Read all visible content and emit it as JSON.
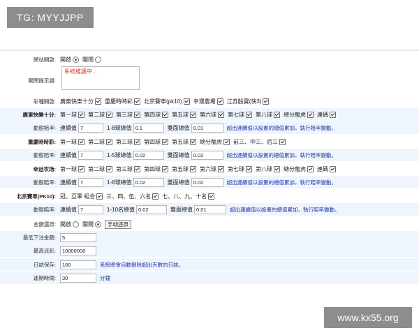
{
  "watermarks": {
    "tg": "TG: MYYJJPP",
    "site": "www.kx55.org"
  },
  "colors": {
    "row_alt": "#eef5fc",
    "hint": "#2233a6",
    "alert_text": "#e0321d"
  },
  "site_status": {
    "label": "網站開啟:",
    "on": "開啟",
    "off": "關閉",
    "selected": "on"
  },
  "close_notice": {
    "label": "關閉提示語:",
    "value": "系統維護中..."
  },
  "lottery_switch": {
    "label": "彩種開啟:",
    "items": [
      "廣東快樂十分",
      "重慶時時彩",
      "北京賽車(pk10)",
      "幸運農場",
      "江苏骰寶(快3)"
    ]
  },
  "gd": {
    "label": "廣東快樂十分:",
    "items": [
      "第一球",
      "第二球",
      "第三球",
      "第四球",
      "第五球",
      "第六球",
      "第七球",
      "第八球",
      "總分龍虎",
      "連碼"
    ],
    "trend_label": "動態賠率:",
    "k1": "連續值",
    "v1": "7",
    "k2": "1-8球總值",
    "v2": "0.1",
    "k3": "雙面總值",
    "v3": "0.01",
    "hint": "超出連續值以設置的總值累加，執行賠率變動。"
  },
  "cq": {
    "label": "重慶時時彩:",
    "items": [
      "第一球",
      "第二球",
      "第三球",
      "第四球",
      "第五球",
      "總分龍虎",
      "前三、中三、后三"
    ],
    "trend_label": "動態賠率:",
    "k1": "連續值",
    "v1": "7",
    "k2": "1-5球總值",
    "v2": "0.02",
    "k3": "雙面總值",
    "v3": "0.02",
    "hint": "超出連續值以設置的總值累加，執行賠率變動。"
  },
  "xy": {
    "label": "幸运农场:",
    "items": [
      "第一球",
      "第二球",
      "第三球",
      "第四球",
      "第五球",
      "第六球",
      "第七球",
      "第八球",
      "總分龍虎",
      "連碼"
    ],
    "trend_label": "動態賠率:",
    "k1": "連續值",
    "v1": "7",
    "k2": "1-8球總值",
    "v2": "0.02",
    "k3": "雙面總值",
    "v3": "0.02",
    "hint": "超出連續值以設置的總值累加，執行賠率變動。"
  },
  "bj": {
    "label": "北京賽車(PK10):",
    "items": [
      "冠、亞軍 組合",
      "三、四、伍、六名",
      "七、八、九、十名"
    ],
    "trend_label": "動態賠率:",
    "k1": "連續值",
    "v1": "7",
    "k2": "1-10名總值",
    "v2": "0.02",
    "k3": "雙面總值",
    "v3": "0.01",
    "hint": "超出連續值以設置的總值累加，執行賠率變動。"
  },
  "refund": {
    "label": "金額還原:",
    "on": "開啟",
    "off": "關閉",
    "selected": "off",
    "button": "手动还原"
  },
  "min_bet": {
    "label": "最低下注金額:",
    "value": "5"
  },
  "max_payout": {
    "label": "最高派彩:",
    "value": "10000000"
  },
  "log_keep": {
    "label": "日誌保存:",
    "value": "100",
    "hint": "系統將會自動刪除超出天數的日誌。"
  },
  "refresh": {
    "label": "遙期時間:",
    "value": "30",
    "unit": "分鐘"
  }
}
